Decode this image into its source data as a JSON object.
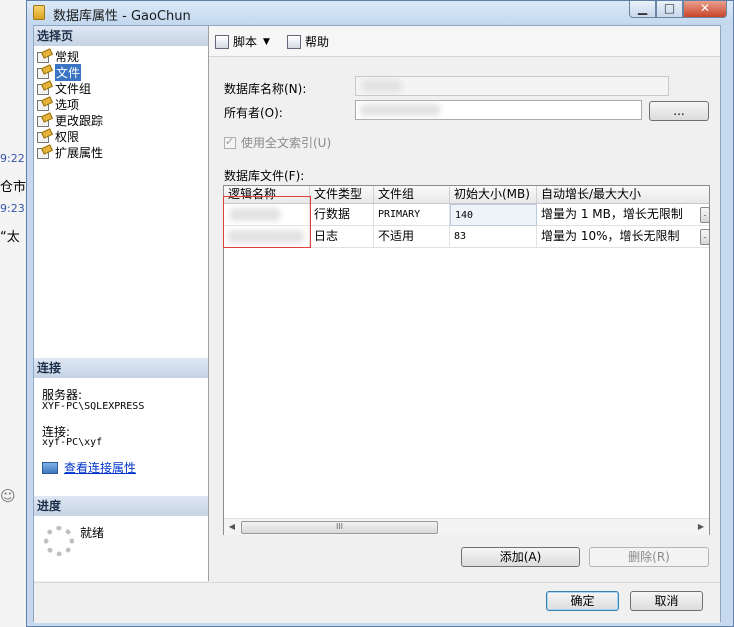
{
  "window": {
    "title": "数据库属性 - GaoChun"
  },
  "background": {
    "lines": [
      "9:22",
      "仓市",
      "9:23",
      "“太"
    ],
    "emoji": "☺"
  },
  "left_panel": {
    "select_page_header": "选择页",
    "pages": [
      {
        "label": "常规",
        "selected": false
      },
      {
        "label": "文件",
        "selected": true
      },
      {
        "label": "文件组",
        "selected": false
      },
      {
        "label": "选项",
        "selected": false
      },
      {
        "label": "更改跟踪",
        "selected": false
      },
      {
        "label": "权限",
        "selected": false
      },
      {
        "label": "扩展属性",
        "selected": false
      }
    ],
    "connection_header": "连接",
    "server_label": "服务器:",
    "server_value": "XYF-PC\\SQLEXPRESS",
    "connection_label": "连接:",
    "connection_value": "xyf-PC\\xyf",
    "view_connection_link": "查看连接属性",
    "progress_header": "进度",
    "progress_status": "就绪"
  },
  "toolbar": {
    "script_label": "脚本",
    "help_label": "帮助"
  },
  "form": {
    "db_name_label": "数据库名称(N):",
    "db_name_value": "",
    "owner_label": "所有者(O):",
    "owner_value": "",
    "owner_browse_button": "...",
    "fulltext_label": "使用全文索引(U)",
    "fulltext_checked": true,
    "db_files_label": "数据库文件(F):"
  },
  "grid": {
    "columns": [
      "逻辑名称",
      "文件类型",
      "文件组",
      "初始大小(MB)",
      "自动增长/最大大小"
    ],
    "rows": [
      {
        "logical_name": "",
        "file_type": "行数据",
        "filegroup": "PRIMARY",
        "initial_size": "140",
        "autogrowth": "增量为 1 MB，增长无限制"
      },
      {
        "logical_name": "",
        "file_type": "日志",
        "filegroup": "不适用",
        "initial_size": "83",
        "autogrowth": "增量为 10%，增长无限制"
      }
    ],
    "scroll_thumb": "III"
  },
  "buttons": {
    "add": "添加(A)",
    "remove": "删除(R)",
    "ok": "确定",
    "cancel": "取消"
  },
  "colors": {
    "selection": "#3a74c4",
    "link": "#0033cc",
    "annotation_box": "#e0403b"
  }
}
